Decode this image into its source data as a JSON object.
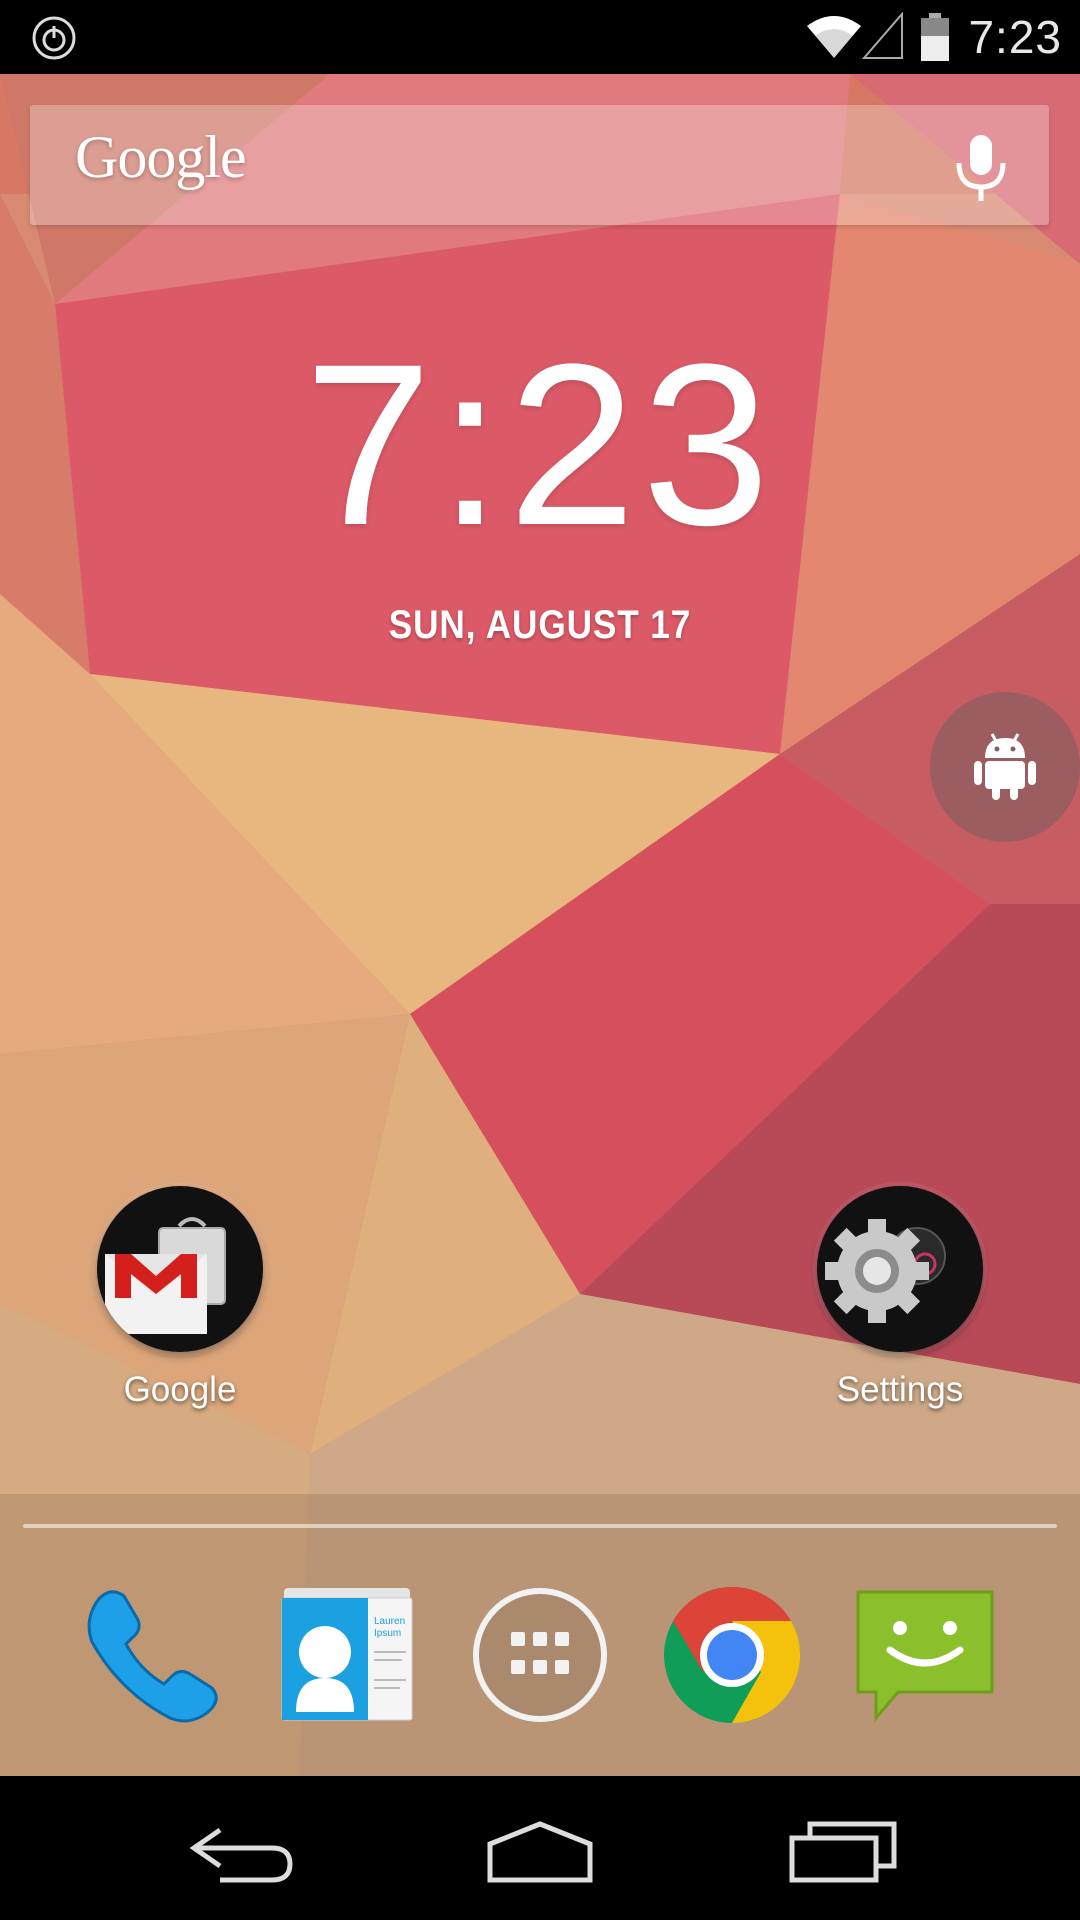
{
  "status_bar": {
    "time": "7:23",
    "icons": [
      "power-icon",
      "wifi-icon",
      "signal-icon",
      "battery-icon"
    ]
  },
  "search": {
    "logo_text": "Google",
    "mic_icon": "mic-icon"
  },
  "clock_widget": {
    "time": "7:23",
    "date": "SUN, AUGUST 17"
  },
  "floating_bubble": {
    "icon": "android-icon"
  },
  "home_apps": [
    {
      "label": "Google",
      "icon": "gmail-folder-icon"
    },
    {
      "label": "Settings",
      "icon": "settings-gear-icon"
    }
  ],
  "dock": [
    {
      "icon": "phone-icon"
    },
    {
      "icon": "contacts-icon",
      "card_text": "Lauren Ipsum"
    },
    {
      "icon": "app-drawer-icon"
    },
    {
      "icon": "chrome-icon"
    },
    {
      "icon": "messaging-icon"
    }
  ],
  "nav_bar": [
    "back-icon",
    "home-icon",
    "recents-icon"
  ],
  "colors": {
    "wallpaper_red": "#d9485c",
    "wallpaper_peach": "#e8a878",
    "wallpaper_tan": "#d6b48e",
    "chrome_red": "#db4437",
    "chrome_green": "#0f9d58",
    "chrome_yellow": "#f4c20d",
    "chrome_blue": "#4285f4",
    "phone_blue": "#1ea0e8",
    "messaging_green": "#8bbf2c"
  }
}
